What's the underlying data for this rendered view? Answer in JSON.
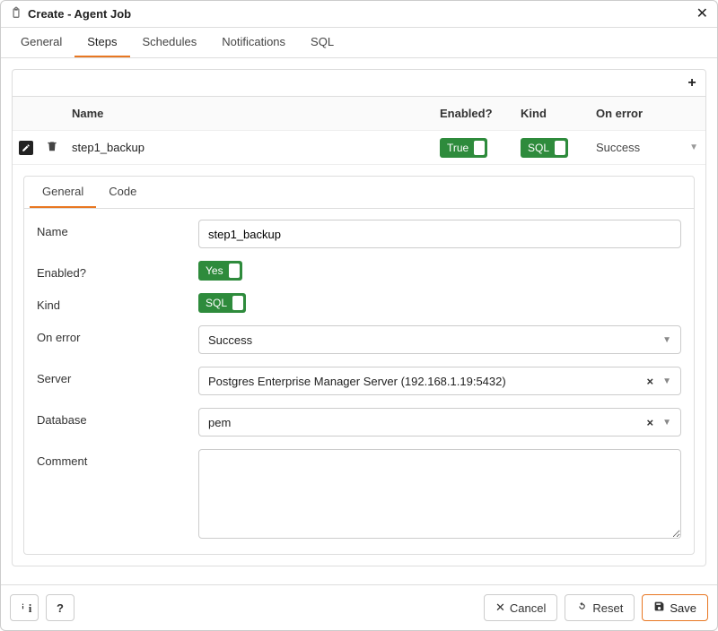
{
  "header": {
    "title": "Create - Agent Job"
  },
  "tabs": [
    "General",
    "Steps",
    "Schedules",
    "Notifications",
    "SQL"
  ],
  "active_tab": "Steps",
  "grid": {
    "columns": {
      "name": "Name",
      "enabled": "Enabled?",
      "kind": "Kind",
      "onerror": "On error"
    },
    "row": {
      "name": "step1_backup",
      "enabled": "True",
      "kind": "SQL",
      "onerror": "Success"
    }
  },
  "sub_tabs": [
    "General",
    "Code"
  ],
  "sub_active": "General",
  "form": {
    "name": {
      "label": "Name",
      "value": "step1_backup"
    },
    "enabled": {
      "label": "Enabled?",
      "value": "Yes"
    },
    "kind": {
      "label": "Kind",
      "value": "SQL"
    },
    "onerror": {
      "label": "On error",
      "value": "Success"
    },
    "server": {
      "label": "Server",
      "value": "Postgres Enterprise Manager Server (192.168.1.19:5432)"
    },
    "database": {
      "label": "Database",
      "value": "pem"
    },
    "comment": {
      "label": "Comment",
      "value": ""
    }
  },
  "footer": {
    "cancel": "Cancel",
    "reset": "Reset",
    "save": "Save"
  }
}
